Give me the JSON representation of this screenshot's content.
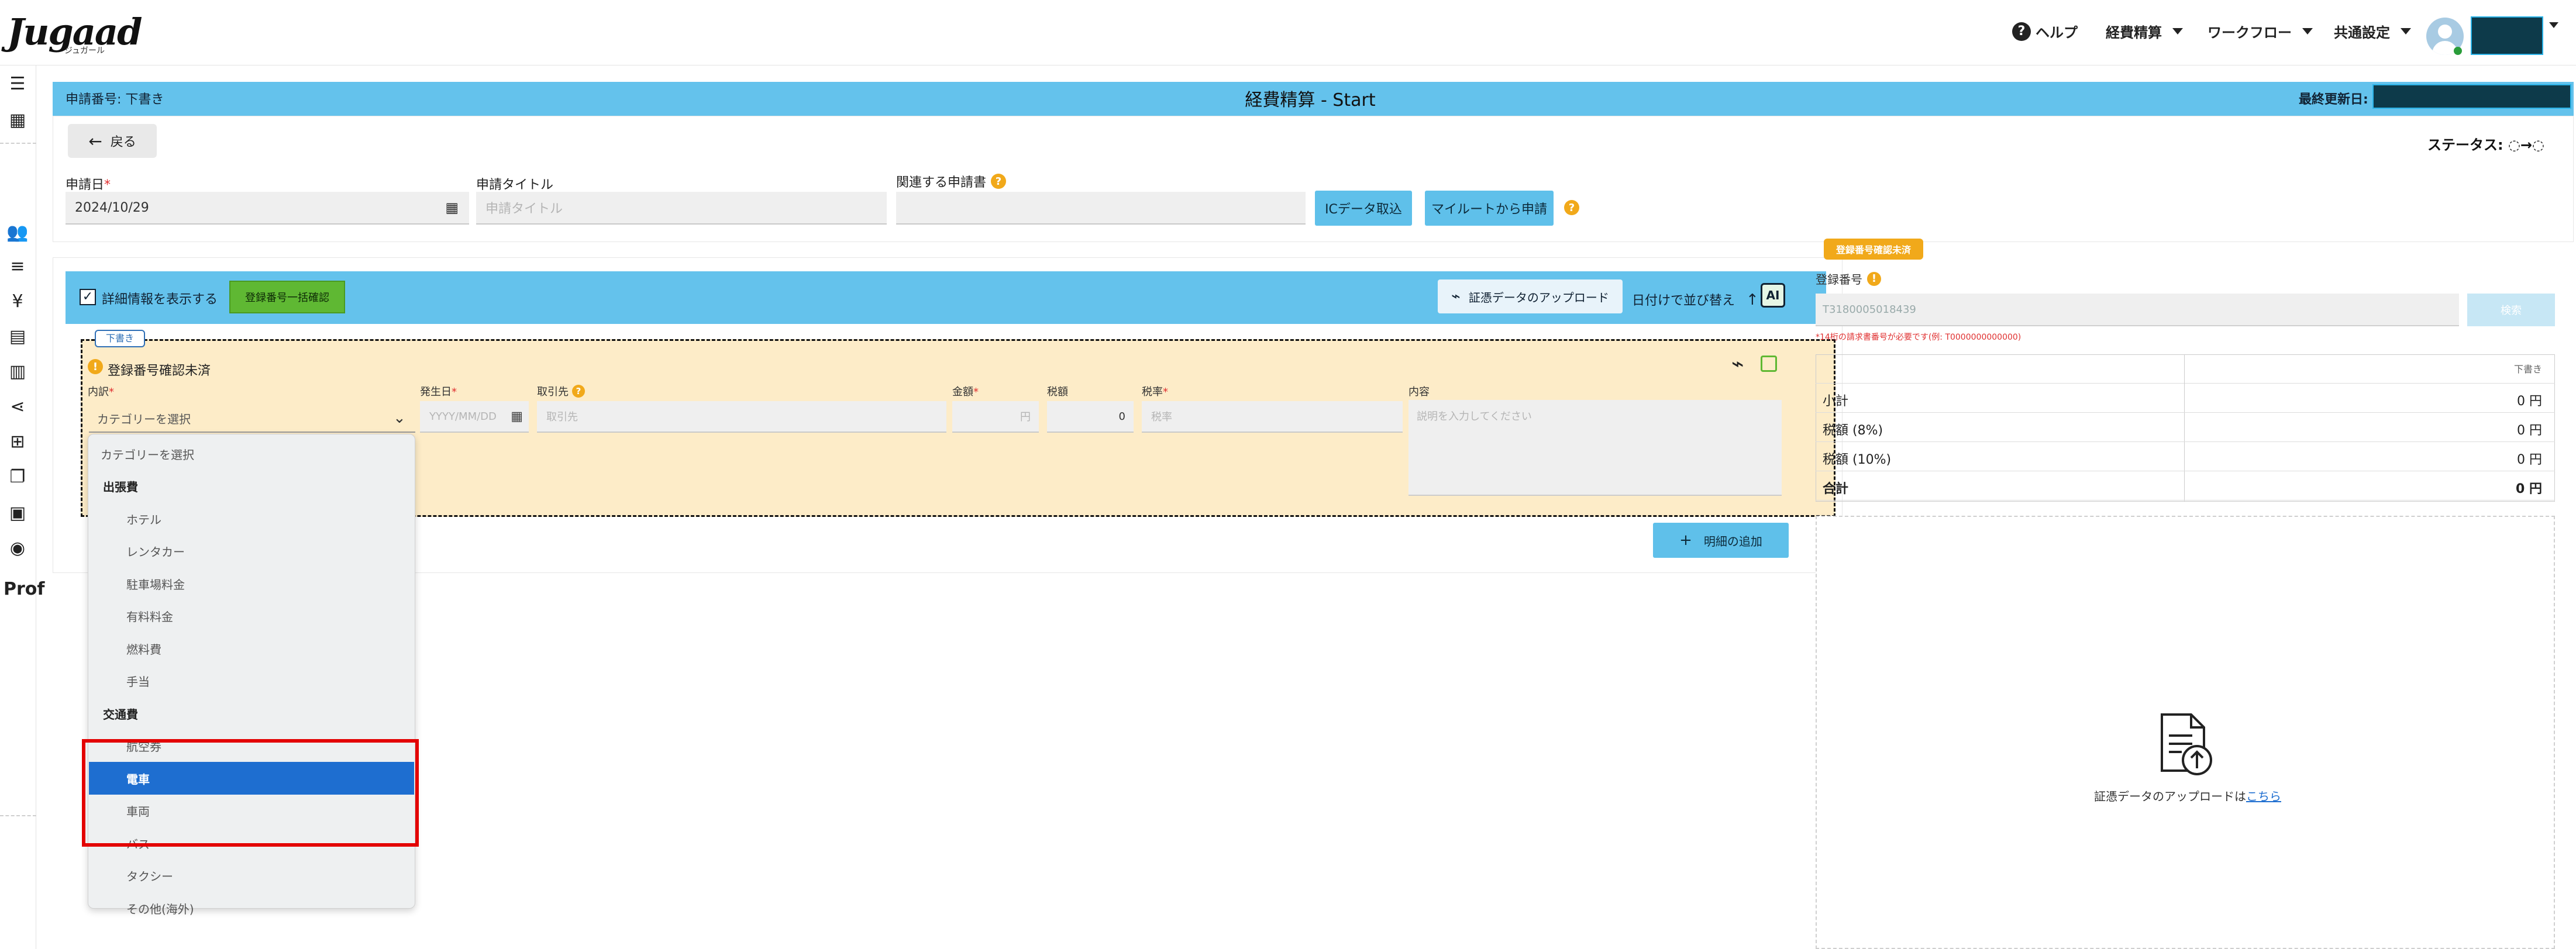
{
  "app": {
    "logo": "Jugaad",
    "logo_sub": "ジュガール"
  },
  "topnav": {
    "help": "ヘルプ",
    "expense": "経費精算",
    "workflow": "ワークフロー",
    "common_settings": "共通設定"
  },
  "rail": {
    "prof": "Prof"
  },
  "header": {
    "request_number": "申請番号: 下書き",
    "title": "経費精算 - Start",
    "last_updated_label": "最終更新日:"
  },
  "form": {
    "back": "戻る",
    "status_label": "ステータス: ◌→◌",
    "application_date_label": "申請日",
    "application_date_value": "2024/10/29",
    "application_title_label": "申請タイトル",
    "application_title_placeholder": "申請タイトル",
    "related_request_label": "関連する申請書",
    "ic_data_button": "ICデータ取込",
    "myroute_button": "マイルートから申請"
  },
  "panel": {
    "show_details_label": "詳細情報を表示する",
    "bulk_check_button": "登録番号一括確認",
    "upload_button": "証憑データのアップロード",
    "sort_label": "日付けで並び替え",
    "ai_label": "AI",
    "draft_tag": "下書き",
    "warning_text": "登録番号確認未済",
    "columns": {
      "category": "内訳",
      "date": "発生日",
      "vendor": "取引先",
      "amount": "金額",
      "tax": "税額",
      "tax_rate": "税率",
      "content": "内容"
    },
    "date_placeholder": "YYYY/MM/DD",
    "vendor_placeholder": "取引先",
    "amount_placeholder": "円",
    "tax_value": "0",
    "tax_rate_placeholder": "税率",
    "content_placeholder": "説明を入力してください",
    "add_detail_button": "明細の追加"
  },
  "dropdown": {
    "selected": "カテゴリーを選択",
    "items": [
      {
        "label": "カテゴリーを選択",
        "kind": "placeholder"
      },
      {
        "label": "出張費",
        "kind": "group"
      },
      {
        "label": "ホテル",
        "kind": "option"
      },
      {
        "label": "レンタカー",
        "kind": "option"
      },
      {
        "label": "駐車場料金",
        "kind": "option"
      },
      {
        "label": "有料料金",
        "kind": "option"
      },
      {
        "label": "燃料費",
        "kind": "option"
      },
      {
        "label": "手当",
        "kind": "option"
      },
      {
        "label": "交通費",
        "kind": "group"
      },
      {
        "label": "航空券",
        "kind": "option"
      },
      {
        "label": "電車",
        "kind": "option",
        "highlighted": true
      },
      {
        "label": "車両",
        "kind": "option"
      },
      {
        "label": "バス",
        "kind": "option"
      },
      {
        "label": "タクシー",
        "kind": "option"
      },
      {
        "label": "その他(海外)",
        "kind": "option"
      }
    ]
  },
  "right": {
    "warning_pill": "登録番号確認未済",
    "reg_number_label": "登録番号",
    "reg_number_value": "T3180005018439",
    "search_button": "検索",
    "hint": "*14桁の請求書番号が必要です(例: T0000000000000)",
    "table_header": "下書き",
    "rows": [
      {
        "label": "小計",
        "value": "0 円"
      },
      {
        "label": "税額 (8%)",
        "value": "0 円"
      },
      {
        "label": "税額 (10%)",
        "value": "0 円"
      },
      {
        "label": "合計",
        "value": "0 円"
      }
    ],
    "upload_text": "証憑データのアップロードは",
    "upload_link": "こちら"
  },
  "colors": {
    "header_blue": "#64c2ec",
    "draft_bg": "#fdecc8",
    "highlight_blue": "#1e6ed0",
    "annotation_red": "#e30000",
    "green_button": "#5fb833"
  }
}
